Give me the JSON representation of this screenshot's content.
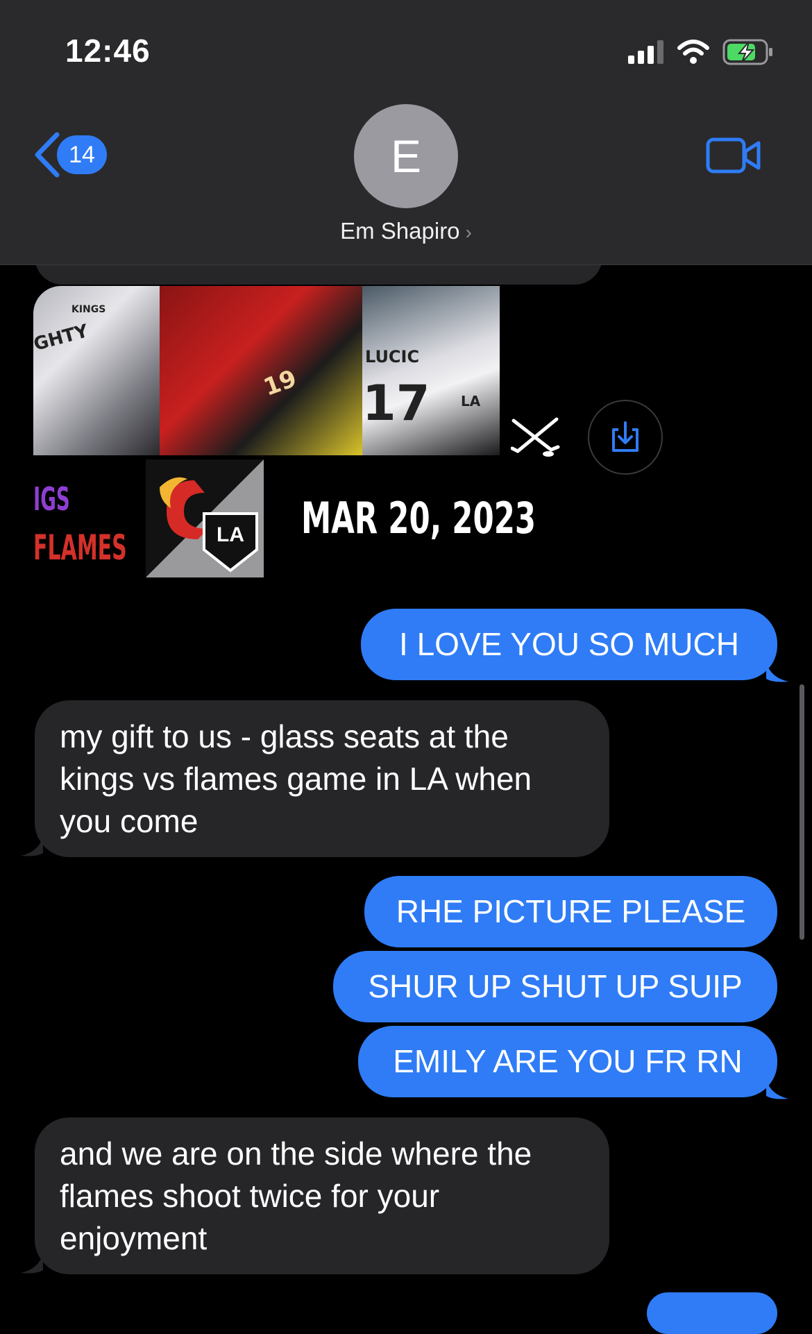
{
  "status_bar": {
    "time": "12:46",
    "icons": [
      "cellular-signal-icon",
      "wifi-icon",
      "battery-charging-icon"
    ],
    "battery_color": "#4cd964"
  },
  "header": {
    "back_badge": "14",
    "avatar_initial": "E",
    "contact_name": "Em Shapiro",
    "accent": "#2f7cf6"
  },
  "attachment": {
    "photo_texts": [
      "KINGS",
      "GHTY",
      "19",
      "LUCIC",
      "17",
      "LA"
    ],
    "banner": {
      "kings_text": "IGS",
      "flames_text": "FLAMES",
      "date": "MAR 20, 2023",
      "logo_text": "LA"
    }
  },
  "messages": [
    {
      "side": "out",
      "text": "I LOVE YOU SO MUCH"
    },
    {
      "side": "in",
      "text": "my gift to us - glass seats at the kings vs flames game in LA when you come"
    },
    {
      "side": "out",
      "text": "RHE PICTURE PLEASE"
    },
    {
      "side": "out",
      "text": "SHUR UP SHUT UP SUIP"
    },
    {
      "side": "out",
      "text": "EMILY ARE YOU FR RN"
    },
    {
      "side": "in",
      "text": "and we are on the side where the flames shoot twice for your enjoyment"
    }
  ],
  "colors": {
    "outgoing_bubble": "#2f7cf6",
    "incoming_bubble": "#262629",
    "header_bg": "#2a2a2c"
  }
}
